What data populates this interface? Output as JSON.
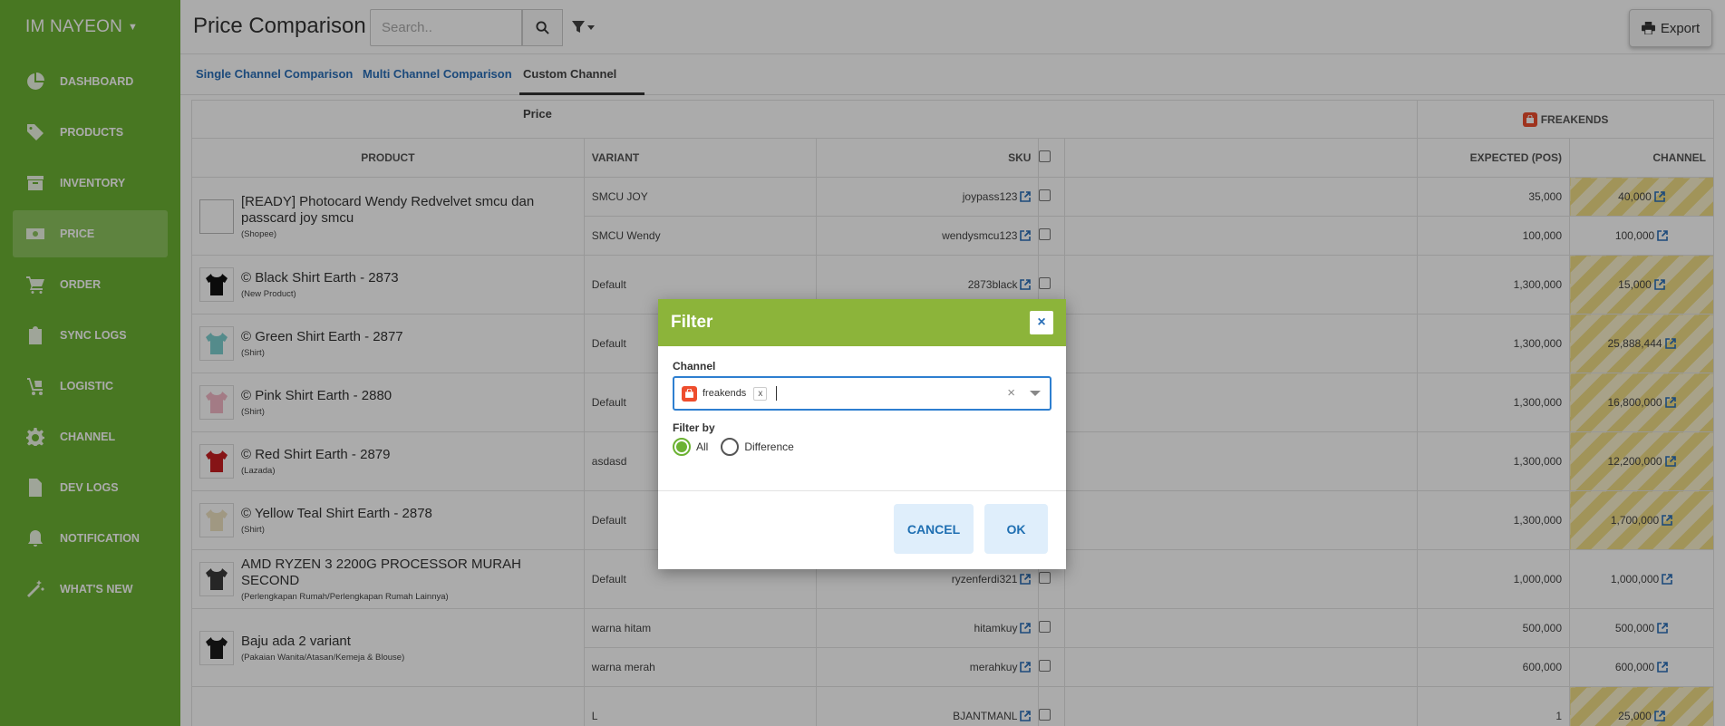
{
  "sidebar": {
    "brand": "IM NAYEON",
    "items": [
      {
        "label": "DASHBOARD",
        "icon": "dashboard-icon"
      },
      {
        "label": "PRODUCTS",
        "icon": "tag-icon"
      },
      {
        "label": "INVENTORY",
        "icon": "inventory-box-icon"
      },
      {
        "label": "PRICE",
        "icon": "money-icon",
        "active": true
      },
      {
        "label": "ORDER",
        "icon": "cart-icon"
      },
      {
        "label": "SYNC LOGS",
        "icon": "clipboard-icon"
      },
      {
        "label": "LOGISTIC",
        "icon": "logistic-cart-icon"
      },
      {
        "label": "CHANNEL",
        "icon": "gear-icon"
      },
      {
        "label": "DEV LOGS",
        "icon": "file-icon"
      },
      {
        "label": "NOTIFICATION",
        "icon": "bell-icon"
      },
      {
        "label": "WHAT'S NEW",
        "icon": "magic-wand-icon"
      }
    ]
  },
  "header": {
    "title": "Price Comparison",
    "search_placeholder": "Search..",
    "export_label": "Export"
  },
  "tabs": [
    {
      "label": "Single Channel Comparison"
    },
    {
      "label": "Multi Channel Comparison"
    },
    {
      "label": "Custom Channel Price",
      "active": true
    }
  ],
  "table": {
    "channel_group": "FREAKENDS",
    "columns": {
      "product": "PRODUCT",
      "variant": "VARIANT",
      "sku": "SKU",
      "expected": "EXPECTED (POS)",
      "channel": "CHANNEL"
    },
    "products": [
      {
        "name": "[READY] Photocard Wendy Redvelvet smcu dan passcard joy smcu",
        "category": "(Shopee)",
        "thumb": "broken",
        "variants": [
          {
            "variant": "SMCU JOY",
            "sku": "joypass123",
            "expected": "35,000",
            "channel": "40,000",
            "striped": true
          },
          {
            "variant": "SMCU Wendy",
            "sku": "wendysmcu123",
            "expected": "100,000",
            "channel": "100,000",
            "striped": false
          }
        ]
      },
      {
        "name": "© Black Shirt Earth - 2873",
        "category": "(New Product)",
        "thumb": "#111111",
        "variants": [
          {
            "variant": "Default",
            "sku": "2873black",
            "expected": "1,300,000",
            "channel": "15,000",
            "striped": true
          }
        ]
      },
      {
        "name": "© Green Shirt Earth - 2877",
        "category": "(Shirt)",
        "thumb": "#7ecfd0",
        "variants": [
          {
            "variant": "Default",
            "sku": "",
            "expected": "1,300,000",
            "channel": "25,888,444",
            "striped": true
          }
        ]
      },
      {
        "name": "© Pink Shirt Earth - 2880",
        "category": "(Shirt)",
        "thumb": "#f3b8c6",
        "variants": [
          {
            "variant": "Default",
            "sku": "",
            "expected": "1,300,000",
            "channel": "16,800,000",
            "striped": true
          }
        ]
      },
      {
        "name": "© Red Shirt Earth - 2879",
        "category": "(Lazada)",
        "thumb": "#c81e22",
        "variants": [
          {
            "variant": "asdasd",
            "sku": "",
            "expected": "1,300,000",
            "channel": "12,200,000",
            "striped": true
          }
        ]
      },
      {
        "name": "© Yellow Teal Shirt Earth - 2878",
        "category": "(Shirt)",
        "thumb": "#efe3c2",
        "variants": [
          {
            "variant": "Default",
            "sku": "",
            "expected": "1,300,000",
            "channel": "1,700,000",
            "striped": true
          }
        ]
      },
      {
        "name": "AMD RYZEN 3 2200G PROCESSOR MURAH SECOND",
        "category": "(Perlengkapan Rumah/Perlengkapan Rumah Lainnya)",
        "thumb": "#3a3a3a",
        "variants": [
          {
            "variant": "Default",
            "sku": "ryzenferdi321",
            "expected": "1,000,000",
            "channel": "1,000,000",
            "striped": false
          }
        ]
      },
      {
        "name": "Baju ada 2 variant",
        "category": "(Pakaian Wanita/Atasan/Kemeja & Blouse)",
        "thumb": "#1a1a1a",
        "variants": [
          {
            "variant": "warna hitam",
            "sku": "hitamkuy",
            "expected": "500,000",
            "channel": "500,000",
            "striped": false
          },
          {
            "variant": "warna merah",
            "sku": "merahkuy",
            "expected": "600,000",
            "channel": "600,000",
            "striped": false
          }
        ]
      },
      {
        "name": "",
        "category": "",
        "thumb": "none",
        "variants": [
          {
            "variant": "L",
            "sku": "BJANTMANL",
            "expected": "1",
            "channel": "25,000",
            "striped": true
          }
        ]
      }
    ]
  },
  "modal": {
    "title": "Filter",
    "close_label": "×",
    "channel_label": "Channel",
    "channel_chip": "freakends",
    "chip_remove": "x",
    "clear_label": "×",
    "filter_by_label": "Filter by",
    "options": [
      {
        "label": "All",
        "checked": true
      },
      {
        "label": "Difference",
        "checked": false
      }
    ],
    "cancel_label": "CANCEL",
    "ok_label": "OK"
  },
  "colors": {
    "sidebar": "#6cb233",
    "modal_header": "#8cb43a",
    "link": "#2a6fb8",
    "shopee": "#ee4d2d"
  }
}
